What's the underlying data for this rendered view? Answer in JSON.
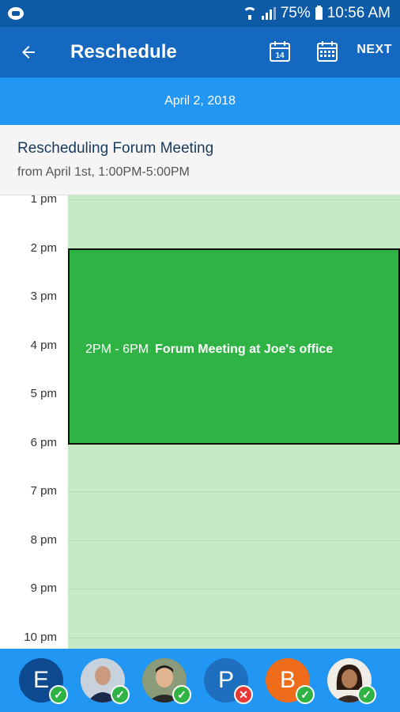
{
  "status_bar": {
    "battery": "75%",
    "time": "10:56 AM"
  },
  "app_bar": {
    "title": "Reschedule",
    "calendar_day": "14",
    "next_label": "NEXT"
  },
  "date_bar": {
    "date": "April 2, 2018"
  },
  "event_info": {
    "title": "Rescheduling Forum Meeting",
    "subtitle": "from April 1st, 1:00PM-5:00PM"
  },
  "timeline": {
    "hours": [
      "1 pm",
      "2 pm",
      "3 pm",
      "4 pm",
      "5 pm",
      "6 pm",
      "7 pm",
      "8 pm",
      "9 pm",
      "10 pm"
    ],
    "event": {
      "time": "2PM - 6PM",
      "name": "Forum Meeting at Joe's office",
      "color": "#2fb344"
    }
  },
  "attendees": [
    {
      "initial": "E",
      "status": "accepted",
      "color": "#0d4a8f"
    },
    {
      "initial": "",
      "status": "accepted",
      "color": "#9aa6b2"
    },
    {
      "initial": "",
      "status": "accepted",
      "color": "#7a8a6e"
    },
    {
      "initial": "P",
      "status": "declined",
      "color": "#1f6fbf"
    },
    {
      "initial": "B",
      "status": "accepted",
      "color": "#ef6c1a"
    },
    {
      "initial": "",
      "status": "accepted",
      "color": "#6d4c3d"
    }
  ],
  "colors": {
    "primary": "#1468bf",
    "accent": "#2196f3",
    "grid": "#c6e9c6"
  }
}
